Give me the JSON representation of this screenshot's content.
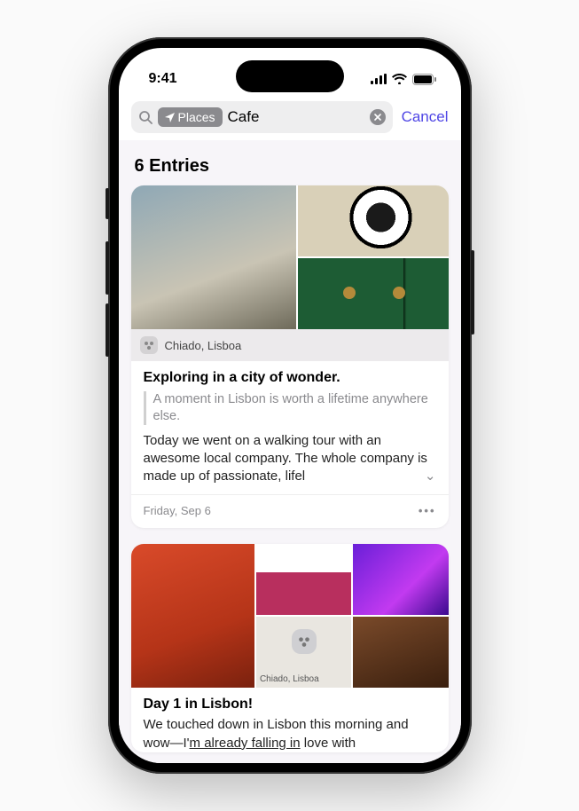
{
  "status": {
    "time": "9:41"
  },
  "search": {
    "filter_label": "Places",
    "query": "Cafe",
    "cancel": "Cancel"
  },
  "results": {
    "heading": "6 Entries"
  },
  "entry1": {
    "location": "Chiado, Lisboa",
    "title": "Exploring in a city of wonder.",
    "quote": "A moment in Lisbon is worth a lifetime anywhere else.",
    "body": "Today we went on a walking tour with an awesome local company. The whole company is made up of passionate, lifel",
    "date": "Friday, Sep 6"
  },
  "entry2": {
    "map_label": "Chiado, Lisboa",
    "title": "Day 1 in Lisbon!",
    "body_pre": "We touched down in Lisbon this morning and wow—I'",
    "body_underlined": "m already falling in",
    "body_post": " love with"
  }
}
